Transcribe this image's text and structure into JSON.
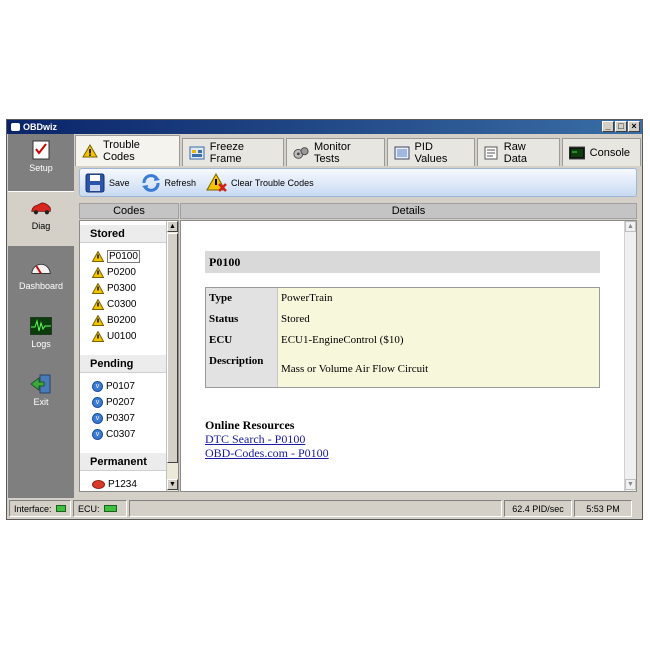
{
  "window": {
    "title": "OBDwiz"
  },
  "nav": [
    {
      "label": "Setup",
      "icon": "checklist-icon"
    },
    {
      "label": "Diag",
      "icon": "car-icon"
    },
    {
      "label": "Dashboard",
      "icon": "gauge-icon"
    },
    {
      "label": "Logs",
      "icon": "waveform-icon"
    },
    {
      "label": "Exit",
      "icon": "exit-door-icon"
    }
  ],
  "tabs": [
    {
      "label": "Trouble Codes",
      "icon": "warning-icon"
    },
    {
      "label": "Freeze Frame",
      "icon": "freeze-frame-icon"
    },
    {
      "label": "Monitor Tests",
      "icon": "monitor-tests-icon"
    },
    {
      "label": "PID Values",
      "icon": "pid-values-icon"
    },
    {
      "label": "Raw Data",
      "icon": "raw-data-icon"
    },
    {
      "label": "Console",
      "icon": "console-icon"
    }
  ],
  "toolbar": {
    "save": "Save",
    "refresh": "Refresh",
    "clear": "Clear Trouble Codes"
  },
  "headers": {
    "codes": "Codes",
    "details": "Details"
  },
  "codes": {
    "stored_label": "Stored",
    "stored": [
      "P0100",
      "P0200",
      "P0300",
      "C0300",
      "B0200",
      "U0100"
    ],
    "pending_label": "Pending",
    "pending": [
      "P0107",
      "P0207",
      "P0307",
      "C0307"
    ],
    "permanent_label": "Permanent",
    "permanent": [
      "P1234"
    ]
  },
  "details": {
    "title": "P0100",
    "rows": [
      {
        "key": "Type",
        "value": "PowerTrain"
      },
      {
        "key": "Status",
        "value": "Stored"
      },
      {
        "key": "ECU",
        "value": "ECU1-EngineControl ($10)"
      },
      {
        "key": "Description",
        "value": "Mass or Volume Air Flow Circuit"
      }
    ],
    "online_heading": "Online Resources",
    "links": [
      "DTC Search - P0100",
      "OBD-Codes.com - P0100"
    ]
  },
  "status": {
    "interface": "Interface:",
    "ecu": "ECU:",
    "rate": "62.4 PID/sec",
    "time": "5:53 PM"
  },
  "colors": {
    "titlebar": "#0a246a",
    "led": "#3fbf3f",
    "link": "#1a1aa6",
    "detail_value_bg": "#f7f7dc"
  }
}
